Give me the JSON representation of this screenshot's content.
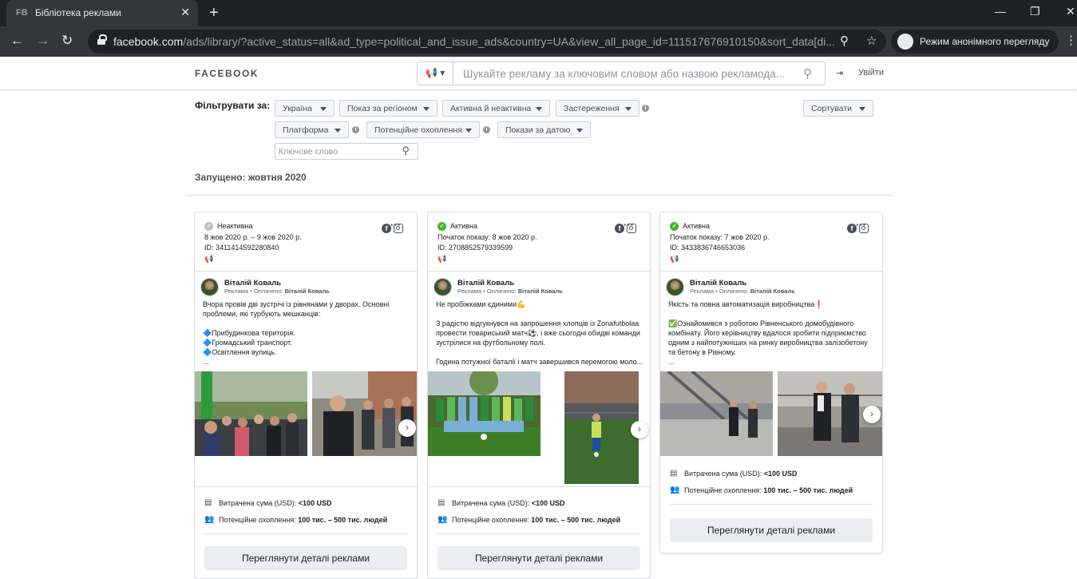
{
  "browser": {
    "tab_favicon": "FB",
    "tab_title": "Бібліотека реклами",
    "url_host": "facebook.com",
    "url_rest": "/ads/library/?active_status=all&ad_type=political_and_issue_ads&country=UA&view_all_page_id=111517676910150&sort_data[di...",
    "incognito_label": "Режим анонімного перегляду"
  },
  "header": {
    "logo": "FACEBOOK",
    "search_placeholder": "Шукайте рекламу за ключовим словом або назвою рекламода...",
    "logout": "Увійти"
  },
  "filters": {
    "label": "Фільтрувати за:",
    "country": "Україна",
    "region": "Показ за регіоном",
    "status": "Активна й неактивна",
    "disclaimers": "Застереження",
    "sort": "Сортувати",
    "platform": "Платформа",
    "reach": "Потенційне охоплення",
    "dates": "Покази за датою",
    "keyword_placeholder": "Ключове слово"
  },
  "launched": "Запущено: жовтня 2020",
  "cards": [
    {
      "status": "Неактивна",
      "status_color": "#bec3c9",
      "dates": "8 жов 2020 р. – 9 жов 2020 р.",
      "id": "ID: 3411414592280840",
      "page": "Віталій Коваль",
      "sponsored": "Реклама • Оплачено: ",
      "payer": "Віталій Коваль",
      "text": "Вчора провів дві зустрічі із рівнянами у дворах. Основні проблеми, які турбують мешканців:\n\n🔷Прибудинкова територія.\n🔷Громадський транспорт.\n🔷Освітлення вулиць.\n...",
      "spent_label": "Витрачена сума (USD): ",
      "spent": "<100 USD",
      "reach_label": "Потенційне охоплення: ",
      "reach": "100 тис. – 500 тис. людей",
      "button": "Переглянути деталі реклами"
    },
    {
      "status": "Активна",
      "status_color": "#42b72a",
      "dates": "Початок показу: 8 жов 2020 р.",
      "id": "ID: 2708852579339599",
      "page": "Віталій Коваль",
      "sponsored": "Реклама • Оплачено: ",
      "payer": "Віталій Коваль",
      "text": "Не пробіжками єдиними💪\n\nЗ радістю відгукнувся на запрошення хлопців із Zonafutbolaa провести товариський матч⚽, і вже сьогодні обидві команди зустрілися на футбольному полі.\n\nГодина потужної баталії і матч завершився перемогою моло...",
      "spent_label": "Витрачена сума (USD): ",
      "spent": "<100 USD",
      "reach_label": "Потенційне охоплення: ",
      "reach": "100 тис. – 500 тис. людей",
      "button": "Переглянути деталі реклами"
    },
    {
      "status": "Активна",
      "status_color": "#42b72a",
      "dates": "Початок показу: 7 жов 2020 р.",
      "id": "ID: 3433836746653036",
      "page": "Віталій Коваль",
      "sponsored": "Реклама • Оплачено: ",
      "payer": "Віталій Коваль",
      "text": "Якість та повна автоматизація виробництва❗\n\n✅Ознайомився з роботою Рівненського домобудівного комбінату. Його керівництву вдалося зробити підприємство одним з найпотужніших на ринку виробництва залізобетону та бетону в Рівному.\n...",
      "spent_label": "Витрачена сума (USD): ",
      "spent": "<100 USD",
      "reach_label": "Потенційне охоплення: ",
      "reach": "100 тис. – 500 тис. людей",
      "button": "Переглянути деталі реклами"
    }
  ]
}
